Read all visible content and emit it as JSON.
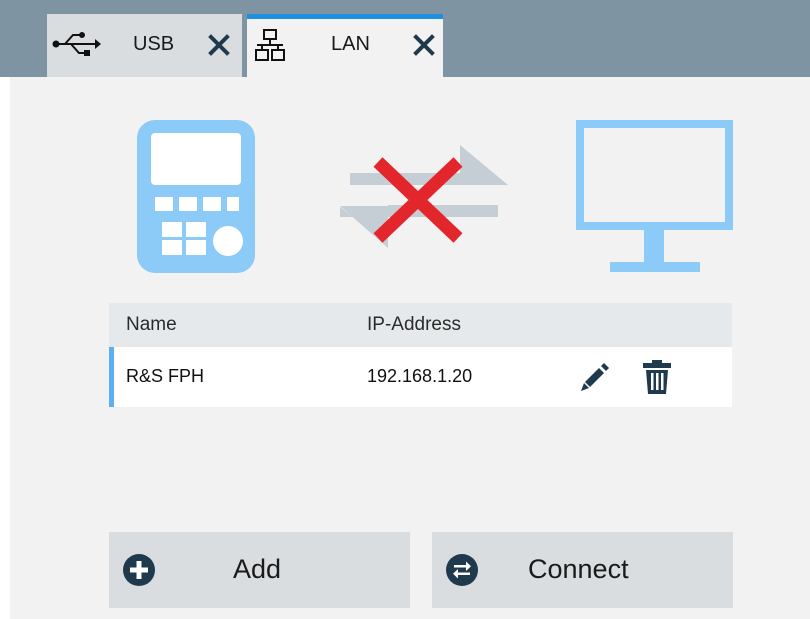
{
  "tabs": [
    {
      "label": "USB",
      "icon": "usb-icon",
      "close_icon": "close-icon",
      "active": false
    },
    {
      "label": "LAN",
      "icon": "network-icon",
      "close_icon": "close-icon",
      "active": true
    }
  ],
  "illustration": {
    "device_icon": "handheld-device-icon",
    "status_icon": "disconnected-icon",
    "computer_icon": "monitor-icon"
  },
  "table": {
    "headers": [
      "Name",
      "IP-Address"
    ],
    "rows": [
      {
        "name": "R&S FPH",
        "ip": "192.168.1.20",
        "edit_icon": "pencil-icon",
        "delete_icon": "trash-icon"
      }
    ]
  },
  "buttons": {
    "add": {
      "label": "Add",
      "icon": "plus-circle-icon"
    },
    "connect": {
      "label": "Connect",
      "icon": "exchange-circle-icon"
    }
  },
  "colors": {
    "topbar": "#7f94a2",
    "panel": "#f2f2f2",
    "active_tab_indicator": "#1f8fe0",
    "illustration_blue": "#8ccbf7",
    "disconnect_red": "#e3262c",
    "arrow_gray": "#c5ced5",
    "button_bg": "#d9dde0",
    "dark_icon": "#1e3a4c"
  }
}
